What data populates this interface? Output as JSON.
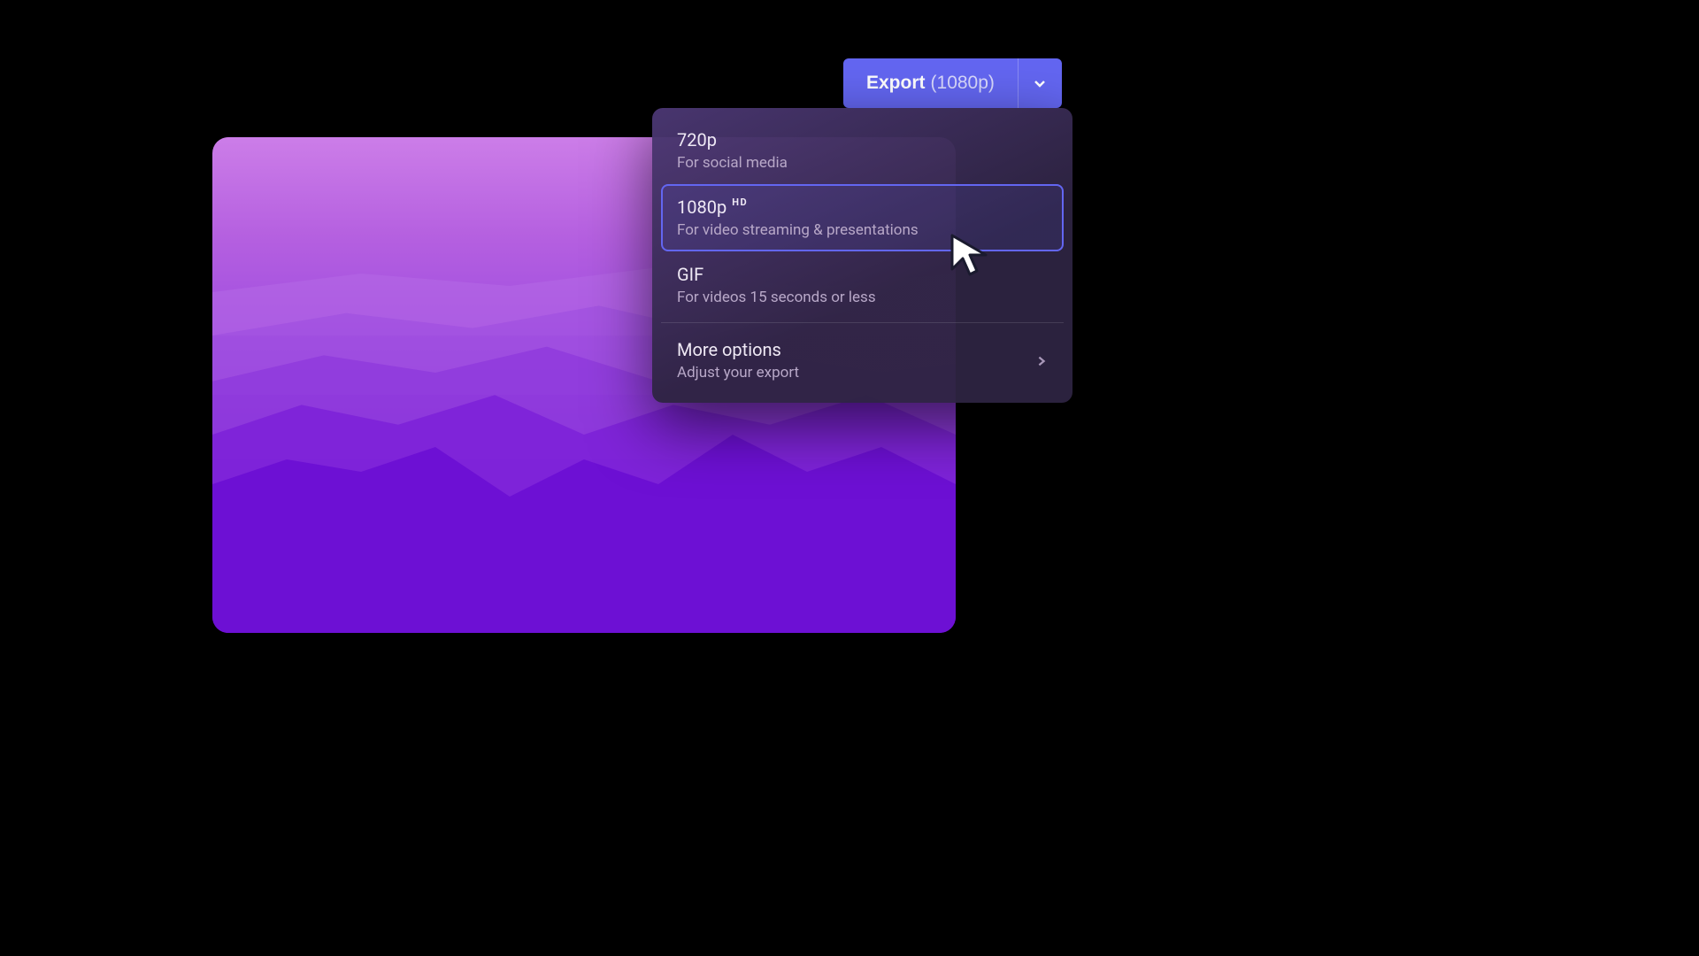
{
  "export_button": {
    "label": "Export",
    "current": "(1080p)"
  },
  "menu": {
    "options": [
      {
        "title": "720p",
        "desc": "For social media",
        "badge": "",
        "selected": false
      },
      {
        "title": "1080p",
        "desc": "For video streaming & presentations",
        "badge": "HD",
        "selected": true
      },
      {
        "title": "GIF",
        "desc": "For videos 15 seconds or less",
        "badge": "",
        "selected": false
      }
    ],
    "more": {
      "title": "More options",
      "desc": "Adjust your export"
    }
  },
  "colors": {
    "accent": "#6366f1",
    "canvas_top": "#cc7de8",
    "canvas_bottom": "#6d10d4"
  }
}
